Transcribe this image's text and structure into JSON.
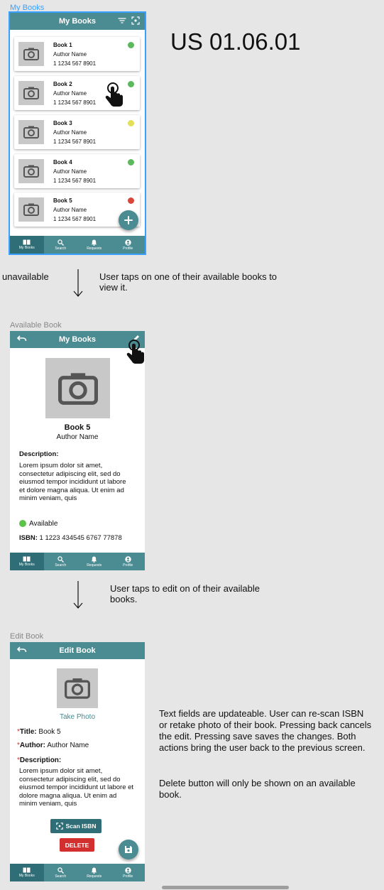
{
  "us_id": "US 01.06.01",
  "frame1": {
    "label": "My Books",
    "title": "My Books",
    "books": [
      {
        "title": "Book 1",
        "author": "Author Name",
        "isbn": "1 1234 567 8901",
        "status_color": "#5cb85c"
      },
      {
        "title": "Book 2",
        "author": "Author Name",
        "isbn": "1 1234 567 8901",
        "status_color": "#5cb85c"
      },
      {
        "title": "Book 3",
        "author": "Author Name",
        "isbn": "1 1234 567 8901",
        "status_color": "#e3df5a"
      },
      {
        "title": "Book 4",
        "author": "Author Name",
        "isbn": "1 1234 567 8901",
        "status_color": "#5cb85c"
      },
      {
        "title": "Book 5",
        "author": "Author Name",
        "isbn": "1 1234 567 8901",
        "status_color": "#d9463a"
      }
    ]
  },
  "nav": {
    "my_books": "My Books",
    "search": "Search",
    "requests": "Requests",
    "profile": "Profile"
  },
  "annotations": {
    "unavailable": "unavailable",
    "step1": "User taps on one of their available books to view it.",
    "step2": "User taps to edit on of their available books.",
    "notes1": "Text fields are updateable. User can re-scan ISBN or retake photo of their book. Pressing back cancels the edit. Pressing save saves the changes. Both actions bring the user back to the previous screen.",
    "notes2": "Delete button will only be shown on an available book."
  },
  "frame2": {
    "label": "Available Book",
    "title": "My Books",
    "book_title": "Book 5",
    "author": "Author Name",
    "description_label": "Description:",
    "description": "Lorem ipsum dolor sit amet, consectetur adipiscing elit, sed do eiusmod tempor incididunt ut labore et dolore magna aliqua. Ut enim ad minim veniam, quis",
    "status": "Available",
    "isbn_label": "ISBN:",
    "isbn": "1 1223 434545 6767 77878"
  },
  "frame3": {
    "label": "Edit Book",
    "title": "Edit Book",
    "take_photo": "Take Photo",
    "required_mark": "*",
    "title_label": "Title:",
    "title_value": "Book 5",
    "author_label": "Author:",
    "author_value": "Author Name",
    "description_label": "Description:",
    "description": "Lorem ipsum dolor sit amet, consectetur adipiscing elit, sed do eiusmod tempor incididunt ut labore et dolore magna aliqua. Ut enim ad minim veniam, quis",
    "scan_isbn": "Scan ISBN",
    "delete": "DELETE"
  },
  "colors": {
    "teal": "#4b8b92",
    "teal_dark": "#2f6e76",
    "delete_red": "#d32f2f",
    "available_green": "#5cb85c"
  }
}
